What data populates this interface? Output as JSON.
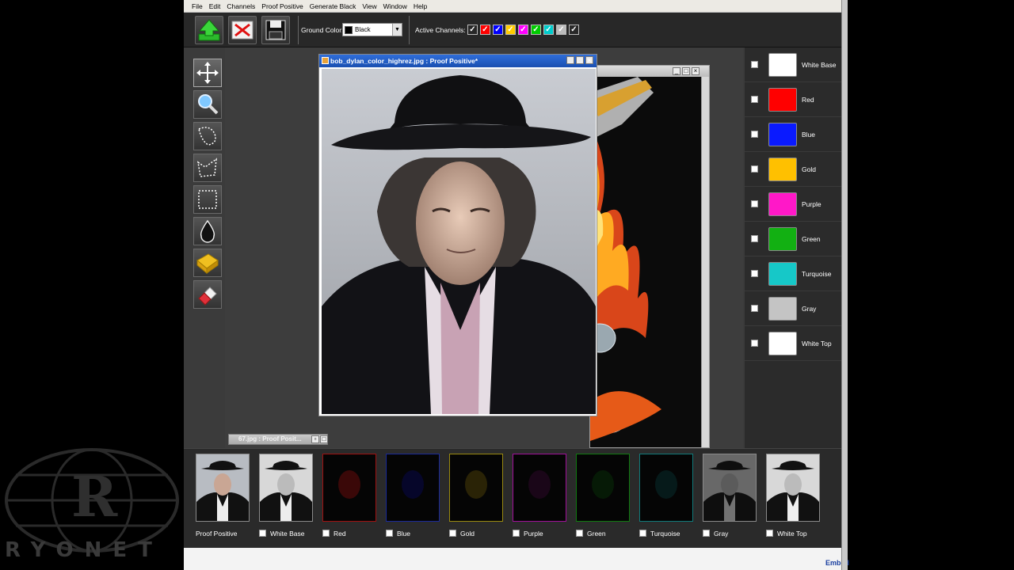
{
  "menu": [
    "File",
    "Edit",
    "Channels",
    "Proof Positive",
    "Generate Black",
    "View",
    "Window",
    "Help"
  ],
  "toolbar": {
    "ground_color_label": "Ground Color:",
    "ground_color_value": "Black",
    "active_channels_label": "Active Channels:",
    "active_channel_colors": [
      "#ffffff",
      "#ff0000",
      "#0000ff",
      "#ffcc00",
      "#ff00ff",
      "#00cc00",
      "#00cccc",
      "#bbbbbb",
      "#ffffff"
    ]
  },
  "tools": [
    "move-icon",
    "zoom-icon",
    "lasso-icon",
    "polygon-lasso-icon",
    "marquee-icon",
    "ink-drop-icon",
    "sponge-icon",
    "eraser-icon"
  ],
  "main_window": {
    "title": "bob_dylan_color_highrez.jpg : Proof Positive*"
  },
  "minimized_window": {
    "title": "67.jpg : Proof Posit..."
  },
  "channels": [
    {
      "label": "White Base",
      "color": "#ffffff"
    },
    {
      "label": "Red",
      "color": "#ff0000"
    },
    {
      "label": "Blue",
      "color": "#0a1aff"
    },
    {
      "label": "Gold",
      "color": "#ffc000"
    },
    {
      "label": "Purple",
      "color": "#ff18c8"
    },
    {
      "label": "Green",
      "color": "#12b012"
    },
    {
      "label": "Turquoise",
      "color": "#16c8c8"
    },
    {
      "label": "Gray",
      "color": "#c4c4c4"
    },
    {
      "label": "White Top",
      "color": "#ffffff"
    }
  ],
  "thumbnails": [
    {
      "label": "Proof Positive",
      "border": "#8a8a8a",
      "checkbox": false
    },
    {
      "label": "White Base",
      "border": "#8a8a8a",
      "checkbox": true
    },
    {
      "label": "Red",
      "border": "#a01010",
      "checkbox": true
    },
    {
      "label": "Blue",
      "border": "#1a2a9a",
      "checkbox": true
    },
    {
      "label": "Gold",
      "border": "#9a8a10",
      "checkbox": true
    },
    {
      "label": "Purple",
      "border": "#a0109a",
      "checkbox": true
    },
    {
      "label": "Green",
      "border": "#107a10",
      "checkbox": true
    },
    {
      "label": "Turquoise",
      "border": "#107a7a",
      "checkbox": true
    },
    {
      "label": "Gray",
      "border": "#8a8a8a",
      "checkbox": true
    },
    {
      "label": "White Top",
      "border": "#8a8a8a",
      "checkbox": true
    }
  ],
  "watermark": "RYONET",
  "embed_text": "Embed"
}
